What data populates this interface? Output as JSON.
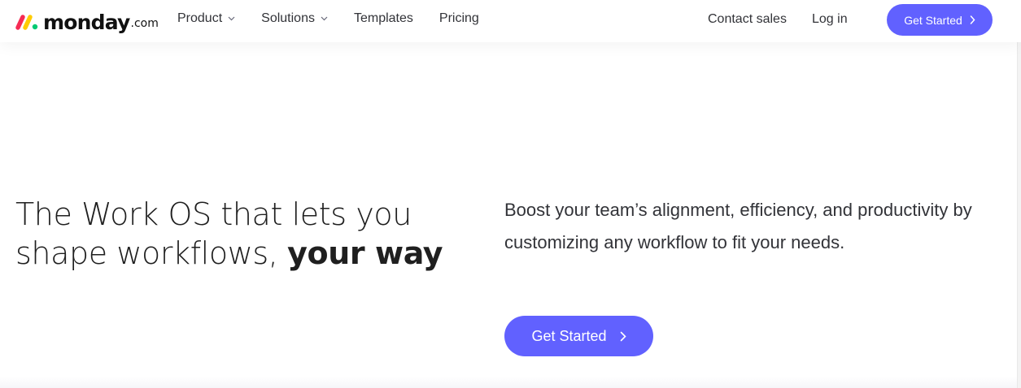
{
  "header": {
    "logo": {
      "word": "monday",
      "suffix": ".com"
    },
    "nav": [
      {
        "label": "Product",
        "has_dropdown": true
      },
      {
        "label": "Solutions",
        "has_dropdown": true
      },
      {
        "label": "Templates",
        "has_dropdown": false
      },
      {
        "label": "Pricing",
        "has_dropdown": false
      }
    ],
    "contact_sales": "Contact sales",
    "login": "Log in",
    "cta": "Get Started"
  },
  "hero": {
    "headline_line1": "The Work OS that lets you",
    "headline_line2_start": "shape workflows, ",
    "headline_line2_emphasis": "your way",
    "subtext": "Boost your team’s alignment, efficiency, and productivity by customizing any workflow to fit your needs.",
    "cta": "Get Started"
  },
  "colors": {
    "brand_primary": "#6161ff",
    "logo_red": "#f62b54",
    "logo_yellow": "#ffcc00",
    "logo_green": "#00ca72",
    "text": "#323338"
  }
}
